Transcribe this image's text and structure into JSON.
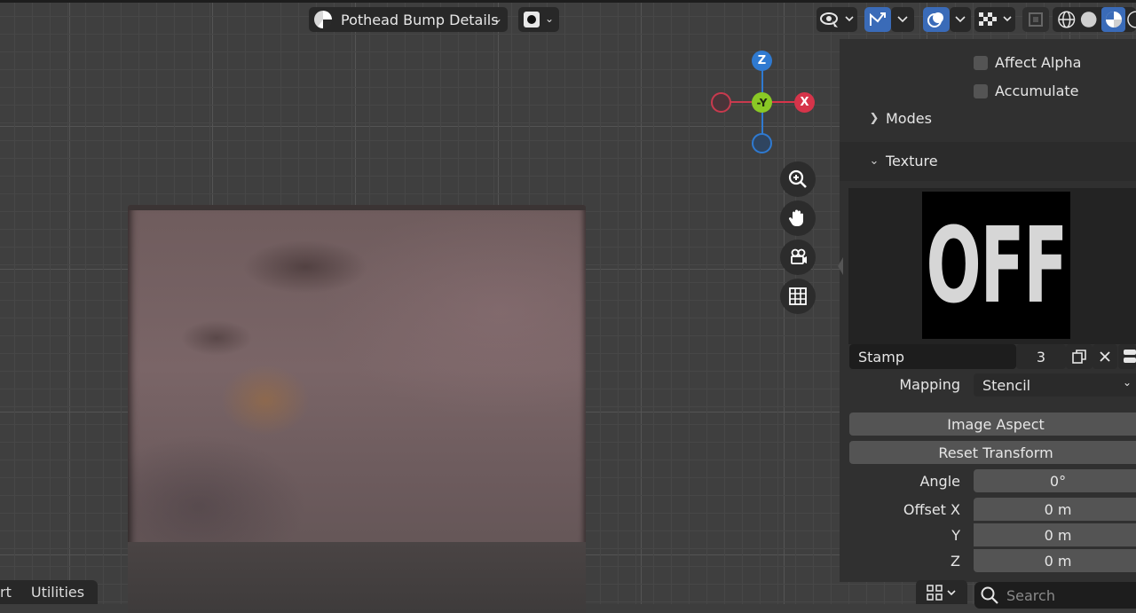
{
  "header": {
    "material_name": "Pothead Bump Details"
  },
  "gizmo": {
    "z_label": "Z",
    "y_label": "-Y",
    "x_label": "X"
  },
  "properties": {
    "affect_alpha": "Affect Alpha",
    "accumulate": "Accumulate",
    "modes_label": "Modes",
    "texture_label": "Texture",
    "preview_text": "OFF",
    "texture_name": "Stamp",
    "texture_users": "3",
    "mapping_label": "Mapping",
    "mapping_value": "Stencil",
    "image_aspect": "Image Aspect",
    "reset_transform": "Reset Transform",
    "angle_label": "Angle",
    "angle_value": "0°",
    "offset_x_label": "Offset X",
    "offset_x_value": "0 m",
    "y_label": "Y",
    "y_value": "0 m",
    "z_label": "Z",
    "z_value": "0 m"
  },
  "bottom": {
    "tab_partial": "rt",
    "tab_utilities": "Utilities",
    "search_placeholder": "Search"
  },
  "colors": {
    "x_axis": "#d6344a",
    "y_axis": "#8ac925",
    "z_axis": "#2f7ad1",
    "active_button": "#3a6bb8"
  }
}
